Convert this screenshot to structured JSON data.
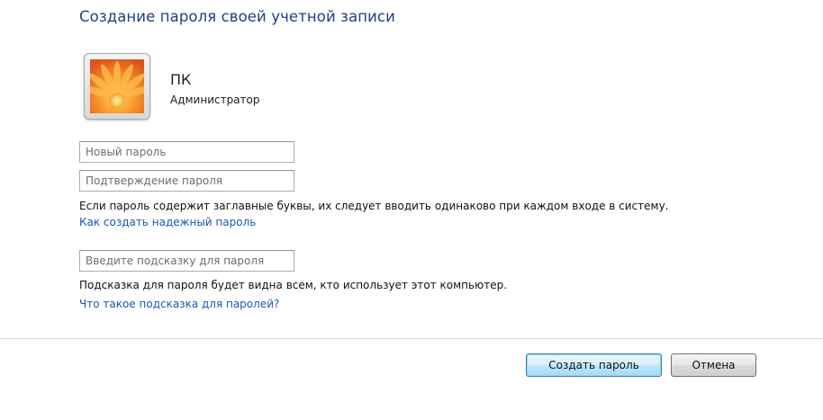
{
  "window": {
    "title": "Создание пароля своей учетной записи"
  },
  "account": {
    "name": "ПК",
    "role": "Администратор",
    "avatar_icon": "orange-flower-icon"
  },
  "form": {
    "new_password_placeholder": "Новый пароль",
    "confirm_password_placeholder": "Подтверждение пароля",
    "case_note": "Если пароль содержит заглавные буквы, их следует вводить одинаково при каждом входе в систему.",
    "strong_password_link": "Как создать надежный пароль",
    "hint_placeholder": "Введите подсказку для пароля",
    "hint_note": "Подсказка для пароля будет видна всем, кто использует этот компьютер.",
    "hint_link": "Что такое подсказка для паролей?"
  },
  "buttons": {
    "create_label": "Создать пароль",
    "cancel_label": "Отмена"
  },
  "colors": {
    "title": "#1f3f86",
    "link": "#1a56b8",
    "primary_border": "#3c7fb1"
  }
}
